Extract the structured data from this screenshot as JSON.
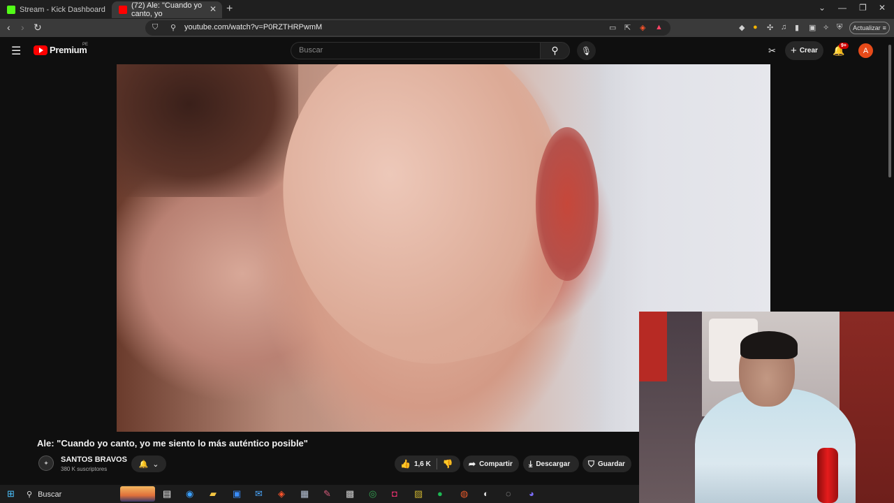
{
  "browser": {
    "tabs": [
      {
        "title": "Stream - Kick Dashboard",
        "favicon_color": "#53fc18"
      },
      {
        "title": "(72) Ale: \"Cuando yo canto, yo",
        "favicon_color": "#ff0000"
      }
    ],
    "url": "youtube.com/watch?v=P0RZTHRPwmM",
    "update_label": "Actualizar"
  },
  "youtube": {
    "logo_text": "Premium",
    "region": "PE",
    "search_placeholder": "Buscar",
    "create_label": "Crear",
    "notification_badge": "9+",
    "avatar_letter": "A"
  },
  "video": {
    "title": "Ale: \"Cuando yo canto, yo me siento lo más auténtico posible\"",
    "channel_name": "SANTOS BRAVOS",
    "subscribers": "380 K suscriptores",
    "likes": "1,6 K",
    "share_label": "Compartir",
    "download_label": "Descargar",
    "save_label": "Guardar"
  },
  "taskbar": {
    "search_label": "Buscar"
  },
  "colors": {
    "youtube_red": "#ff0000",
    "background": "#0f0f0f",
    "kick_green": "#53fc18"
  }
}
